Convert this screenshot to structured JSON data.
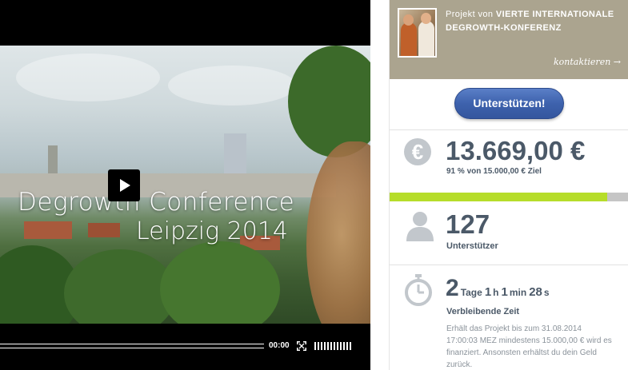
{
  "video": {
    "title": "Degrowth Conference",
    "subtitle": "Leipzig 2014",
    "time": "00:00"
  },
  "owner": {
    "label": "Projekt von",
    "name": "VIERTE INTERNATIONALE DEGROWTH-KONFERENZ",
    "contact": "kontaktieren →"
  },
  "support_button": "Unterstützen!",
  "funding": {
    "amount": "13.669,00 €",
    "goal_text": "91 % von 15.000,00 € Ziel",
    "progress_fraction": 0.91
  },
  "supporters": {
    "count": "127",
    "label": "Unterstützer"
  },
  "remaining": {
    "days": "2",
    "days_unit": "Tage",
    "hours": "1",
    "hours_unit": "h",
    "minutes": "1",
    "minutes_unit": "min",
    "seconds": "28",
    "seconds_unit": "s",
    "label": "Verbleibende Zeit",
    "note": "Erhält das Projekt bis zum 31.08.2014 17:00:03 MEZ mindestens 15.000,00 € wird es finanziert. Ansonsten erhältst du dein Geld zurück."
  },
  "colors": {
    "accent_blue": "#3e62ad",
    "progress_green": "#b6dd2a",
    "owner_panel": "#aba48f",
    "stat_text": "#4b5968"
  },
  "icons": [
    "play-icon",
    "fullscreen-icon",
    "volume-icon",
    "euro-icon",
    "user-icon",
    "stopwatch-icon",
    "arrow-right-icon"
  ]
}
